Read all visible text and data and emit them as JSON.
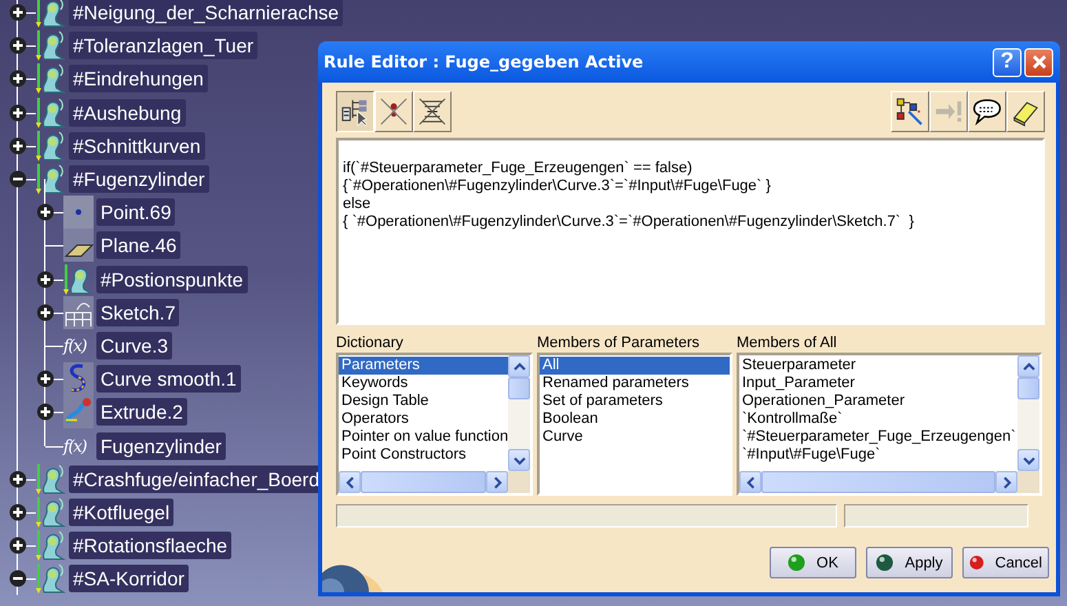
{
  "tree": [
    {
      "name": "#Neigung_der_Scharnierachse",
      "kind": "feature",
      "expanded": false
    },
    {
      "name": "#Toleranzlagen_Tuer",
      "kind": "feature",
      "expanded": false
    },
    {
      "name": "#Eindrehungen",
      "kind": "feature",
      "expanded": false
    },
    {
      "name": "#Aushebung",
      "kind": "feature",
      "expanded": false
    },
    {
      "name": "#Schnittkurven",
      "kind": "feature",
      "expanded": false
    },
    {
      "name": "#Fugenzylinder",
      "kind": "feature",
      "expanded": true,
      "children": [
        {
          "name": "Point.69",
          "kind": "point",
          "expanded": false
        },
        {
          "name": "Plane.46",
          "kind": "plane"
        },
        {
          "name": "#Postionspunkte",
          "kind": "feature",
          "expanded": false
        },
        {
          "name": "Sketch.7",
          "kind": "sketch",
          "expanded": false
        },
        {
          "name": "Curve.3",
          "kind": "formula",
          "symbol": "f(x)"
        },
        {
          "name": "Curve smooth.1",
          "kind": "curve",
          "expanded": false
        },
        {
          "name": "Extrude.2",
          "kind": "extrude",
          "expanded": false
        },
        {
          "name": "Fugenzylinder",
          "kind": "formula",
          "symbol": "f(x)"
        }
      ]
    },
    {
      "name": "#Crashfuge/einfacher_Boerd",
      "kind": "feature",
      "expanded": false
    },
    {
      "name": "#Kotfluegel",
      "kind": "feature",
      "expanded": false
    },
    {
      "name": "#Rotationsflaeche",
      "kind": "feature",
      "expanded": false
    },
    {
      "name": "#SA-Korridor",
      "kind": "feature",
      "expanded": true
    }
  ],
  "dialog": {
    "title": "Rule Editor : Fuge_gegeben Active",
    "help_button": "?",
    "left_tools": [
      {
        "kind": "tree-select",
        "pressed": true
      },
      {
        "kind": "no-check",
        "pressed": false
      },
      {
        "kind": "no-lines",
        "pressed": false
      }
    ],
    "right_tools": [
      {
        "kind": "wand",
        "disabled": false
      },
      {
        "kind": "jump",
        "disabled": true
      },
      {
        "kind": "comment",
        "disabled": false
      },
      {
        "kind": "eraser",
        "disabled": false
      }
    ],
    "editor_lines": [
      "if(`#Steuerparameter_Fuge_Erzeugengen` == false)",
      "{`#Operationen\\#Fugenzylinder\\Curve.3`=`#Input\\#Fuge\\Fuge` }",
      "else",
      "{ `#Operationen\\#Fugenzylinder\\Curve.3`=`#Operationen\\#Fugenzylinder\\Sketch.7`  }"
    ],
    "lists": [
      {
        "label": "Dictionary",
        "scrollbars": true,
        "items": [
          {
            "text": "Parameters",
            "selected": true
          },
          {
            "text": "Keywords",
            "selected": false
          },
          {
            "text": "Design Table",
            "selected": false
          },
          {
            "text": "Operators",
            "selected": false
          },
          {
            "text": "Pointer on value function",
            "selected": false
          },
          {
            "text": "Point Constructors",
            "selected": false
          }
        ]
      },
      {
        "label": "Members of Parameters",
        "scrollbars": false,
        "items": [
          {
            "text": "All",
            "selected": true
          },
          {
            "text": "Renamed parameters",
            "selected": false
          },
          {
            "text": "Set of parameters",
            "selected": false
          },
          {
            "text": "Boolean",
            "selected": false
          },
          {
            "text": "Curve",
            "selected": false
          }
        ]
      },
      {
        "label": "Members of All",
        "scrollbars": true,
        "items": [
          {
            "text": "Steuerparameter",
            "selected": false
          },
          {
            "text": "Input_Parameter",
            "selected": false
          },
          {
            "text": "Operationen_Parameter",
            "selected": false
          },
          {
            "text": "`Kontrollmaße`",
            "selected": false
          },
          {
            "text": "`#Steuerparameter_Fuge_Erzeugengen`",
            "selected": false
          },
          {
            "text": "`#Input\\#Fuge\\Fuge`",
            "selected": false
          }
        ]
      }
    ],
    "buttons": [
      {
        "label": "OK",
        "color": "#1ea01e"
      },
      {
        "label": "Apply",
        "color": "#1d5a40"
      },
      {
        "label": "Cancel",
        "color": "#d61e1e"
      }
    ]
  }
}
